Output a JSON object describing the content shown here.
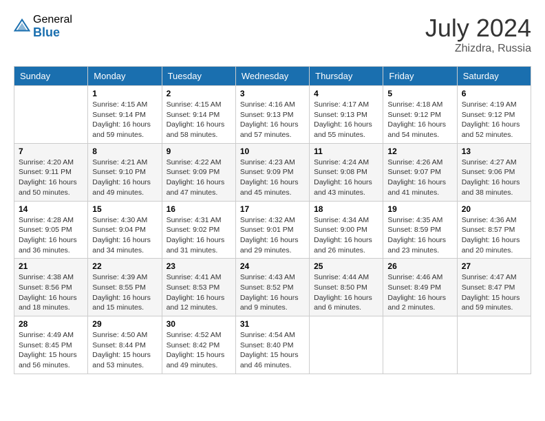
{
  "header": {
    "logo_general": "General",
    "logo_blue": "Blue",
    "month_year": "July 2024",
    "location": "Zhizdra, Russia"
  },
  "weekdays": [
    "Sunday",
    "Monday",
    "Tuesday",
    "Wednesday",
    "Thursday",
    "Friday",
    "Saturday"
  ],
  "weeks": [
    [
      {
        "day": null,
        "info": null
      },
      {
        "day": "1",
        "sunrise": "4:15 AM",
        "sunset": "9:14 PM",
        "daylight": "16 hours and 59 minutes."
      },
      {
        "day": "2",
        "sunrise": "4:15 AM",
        "sunset": "9:14 PM",
        "daylight": "16 hours and 58 minutes."
      },
      {
        "day": "3",
        "sunrise": "4:16 AM",
        "sunset": "9:13 PM",
        "daylight": "16 hours and 57 minutes."
      },
      {
        "day": "4",
        "sunrise": "4:17 AM",
        "sunset": "9:13 PM",
        "daylight": "16 hours and 55 minutes."
      },
      {
        "day": "5",
        "sunrise": "4:18 AM",
        "sunset": "9:12 PM",
        "daylight": "16 hours and 54 minutes."
      },
      {
        "day": "6",
        "sunrise": "4:19 AM",
        "sunset": "9:12 PM",
        "daylight": "16 hours and 52 minutes."
      }
    ],
    [
      {
        "day": "7",
        "sunrise": "4:20 AM",
        "sunset": "9:11 PM",
        "daylight": "16 hours and 50 minutes."
      },
      {
        "day": "8",
        "sunrise": "4:21 AM",
        "sunset": "9:10 PM",
        "daylight": "16 hours and 49 minutes."
      },
      {
        "day": "9",
        "sunrise": "4:22 AM",
        "sunset": "9:09 PM",
        "daylight": "16 hours and 47 minutes."
      },
      {
        "day": "10",
        "sunrise": "4:23 AM",
        "sunset": "9:09 PM",
        "daylight": "16 hours and 45 minutes."
      },
      {
        "day": "11",
        "sunrise": "4:24 AM",
        "sunset": "9:08 PM",
        "daylight": "16 hours and 43 minutes."
      },
      {
        "day": "12",
        "sunrise": "4:26 AM",
        "sunset": "9:07 PM",
        "daylight": "16 hours and 41 minutes."
      },
      {
        "day": "13",
        "sunrise": "4:27 AM",
        "sunset": "9:06 PM",
        "daylight": "16 hours and 38 minutes."
      }
    ],
    [
      {
        "day": "14",
        "sunrise": "4:28 AM",
        "sunset": "9:05 PM",
        "daylight": "16 hours and 36 minutes."
      },
      {
        "day": "15",
        "sunrise": "4:30 AM",
        "sunset": "9:04 PM",
        "daylight": "16 hours and 34 minutes."
      },
      {
        "day": "16",
        "sunrise": "4:31 AM",
        "sunset": "9:02 PM",
        "daylight": "16 hours and 31 minutes."
      },
      {
        "day": "17",
        "sunrise": "4:32 AM",
        "sunset": "9:01 PM",
        "daylight": "16 hours and 29 minutes."
      },
      {
        "day": "18",
        "sunrise": "4:34 AM",
        "sunset": "9:00 PM",
        "daylight": "16 hours and 26 minutes."
      },
      {
        "day": "19",
        "sunrise": "4:35 AM",
        "sunset": "8:59 PM",
        "daylight": "16 hours and 23 minutes."
      },
      {
        "day": "20",
        "sunrise": "4:36 AM",
        "sunset": "8:57 PM",
        "daylight": "16 hours and 20 minutes."
      }
    ],
    [
      {
        "day": "21",
        "sunrise": "4:38 AM",
        "sunset": "8:56 PM",
        "daylight": "16 hours and 18 minutes."
      },
      {
        "day": "22",
        "sunrise": "4:39 AM",
        "sunset": "8:55 PM",
        "daylight": "16 hours and 15 minutes."
      },
      {
        "day": "23",
        "sunrise": "4:41 AM",
        "sunset": "8:53 PM",
        "daylight": "16 hours and 12 minutes."
      },
      {
        "day": "24",
        "sunrise": "4:43 AM",
        "sunset": "8:52 PM",
        "daylight": "16 hours and 9 minutes."
      },
      {
        "day": "25",
        "sunrise": "4:44 AM",
        "sunset": "8:50 PM",
        "daylight": "16 hours and 6 minutes."
      },
      {
        "day": "26",
        "sunrise": "4:46 AM",
        "sunset": "8:49 PM",
        "daylight": "16 hours and 2 minutes."
      },
      {
        "day": "27",
        "sunrise": "4:47 AM",
        "sunset": "8:47 PM",
        "daylight": "15 hours and 59 minutes."
      }
    ],
    [
      {
        "day": "28",
        "sunrise": "4:49 AM",
        "sunset": "8:45 PM",
        "daylight": "15 hours and 56 minutes."
      },
      {
        "day": "29",
        "sunrise": "4:50 AM",
        "sunset": "8:44 PM",
        "daylight": "15 hours and 53 minutes."
      },
      {
        "day": "30",
        "sunrise": "4:52 AM",
        "sunset": "8:42 PM",
        "daylight": "15 hours and 49 minutes."
      },
      {
        "day": "31",
        "sunrise": "4:54 AM",
        "sunset": "8:40 PM",
        "daylight": "15 hours and 46 minutes."
      },
      {
        "day": null,
        "info": null
      },
      {
        "day": null,
        "info": null
      },
      {
        "day": null,
        "info": null
      }
    ]
  ],
  "labels": {
    "sunrise": "Sunrise:",
    "sunset": "Sunset:",
    "daylight": "Daylight:"
  }
}
